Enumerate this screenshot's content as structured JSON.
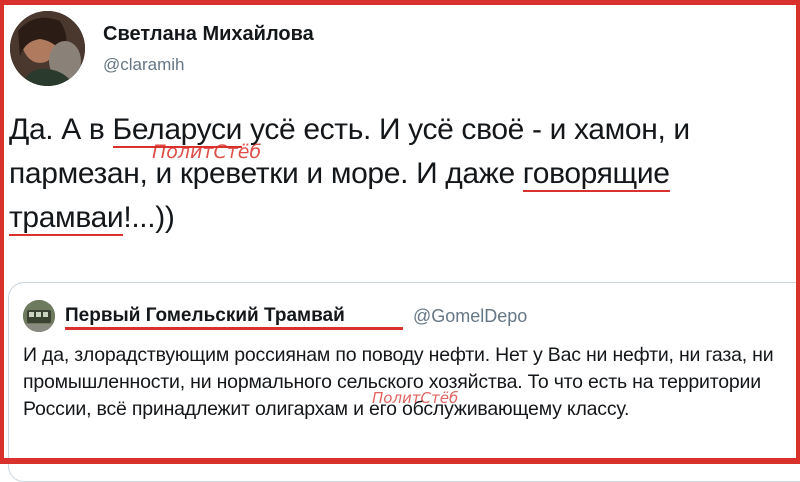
{
  "tweet": {
    "author_name": "Светлана Михайлова",
    "author_handle": "@claramih",
    "text_1": "Да. А в ",
    "text_underlined_1": "Беларуси",
    "text_2": " усё есть. И усё своё - и хамон, и\nпармезан, и креветки и море. И даже ",
    "text_underlined_2": "говорящие\nтрамваи",
    "text_3": "!...))"
  },
  "quoted_tweet": {
    "author_name": "Первый Гомельский Трамвай",
    "author_handle": "@GomelDepo",
    "text": "И да, злорадствующим россиянам по поводу нефти. Нет у Вас ни нефти, ни газа, ни промышленности, ни нормального сельского хозяйства. То что есть на территории России, всё принадлежит олигархам и его обслуживающему классу."
  },
  "watermark": {
    "text_1": "ПолитСтёб",
    "text_2": "ПолитСтёб"
  },
  "colors": {
    "accent_red": "#d9312b",
    "text_primary": "#14171a",
    "text_secondary": "#657786",
    "card_border": "#ccd6dd"
  }
}
